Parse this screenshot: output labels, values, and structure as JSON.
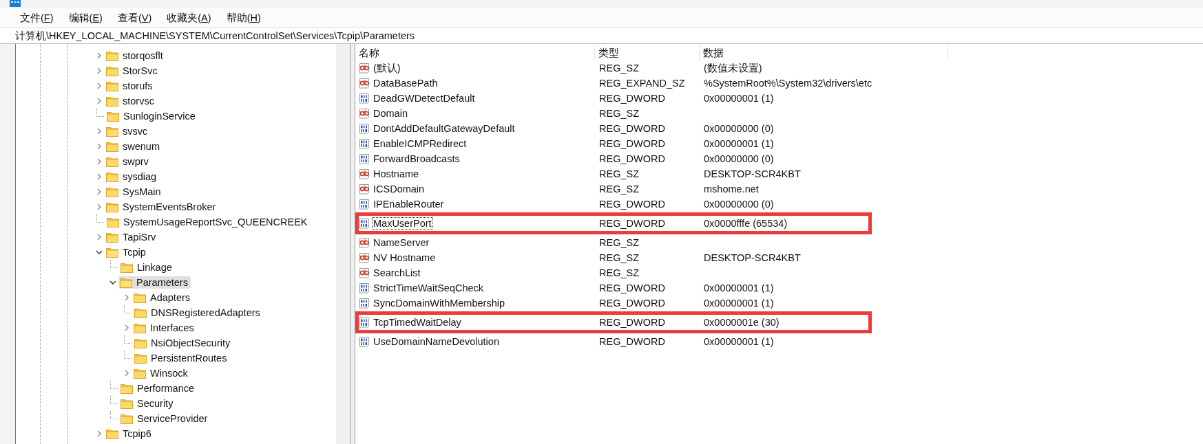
{
  "menu": [
    {
      "before": "文件(",
      "key": "F",
      "after": ")"
    },
    {
      "before": "编辑(",
      "key": "E",
      "after": ")"
    },
    {
      "before": "查看(",
      "key": "V",
      "after": ")"
    },
    {
      "before": "收藏夹(",
      "key": "A",
      "after": ")"
    },
    {
      "before": "帮助(",
      "key": "H",
      "after": ")"
    }
  ],
  "address": "计算机\\HKEY_LOCAL_MACHINE\\SYSTEM\\CurrentControlSet\\Services\\Tcpip\\Parameters",
  "tree": [
    {
      "label": "storqosflt",
      "expandable": true,
      "expanded": false,
      "selected": false
    },
    {
      "label": "StorSvc",
      "expandable": true,
      "expanded": false,
      "selected": false
    },
    {
      "label": "storufs",
      "expandable": true,
      "expanded": false,
      "selected": false
    },
    {
      "label": "storvsc",
      "expandable": true,
      "expanded": false,
      "selected": false
    },
    {
      "label": "SunloginService",
      "expandable": false,
      "selected": false
    },
    {
      "label": "svsvc",
      "expandable": true,
      "expanded": false,
      "selected": false
    },
    {
      "label": "swenum",
      "expandable": true,
      "expanded": false,
      "selected": false
    },
    {
      "label": "swprv",
      "expandable": true,
      "expanded": false,
      "selected": false
    },
    {
      "label": "sysdiag",
      "expandable": true,
      "expanded": false,
      "selected": false
    },
    {
      "label": "SysMain",
      "expandable": true,
      "expanded": false,
      "selected": false
    },
    {
      "label": "SystemEventsBroker",
      "expandable": true,
      "expanded": false,
      "selected": false
    },
    {
      "label": "SystemUsageReportSvc_QUEENCREEK",
      "expandable": false,
      "selected": false
    },
    {
      "label": "TapiSrv",
      "expandable": true,
      "expanded": false,
      "selected": false
    },
    {
      "label": "Tcpip",
      "expandable": true,
      "expanded": true,
      "selected": false,
      "children": [
        {
          "label": "Linkage",
          "expandable": false,
          "selected": false
        },
        {
          "label": "Parameters",
          "expandable": true,
          "expanded": true,
          "selected": true,
          "children": [
            {
              "label": "Adapters",
              "expandable": true,
              "expanded": false,
              "selected": false
            },
            {
              "label": "DNSRegisteredAdapters",
              "expandable": false,
              "selected": false
            },
            {
              "label": "Interfaces",
              "expandable": true,
              "expanded": false,
              "selected": false
            },
            {
              "label": "NsiObjectSecurity",
              "expandable": false,
              "selected": false
            },
            {
              "label": "PersistentRoutes",
              "expandable": false,
              "selected": false
            },
            {
              "label": "Winsock",
              "expandable": true,
              "expanded": false,
              "selected": false
            }
          ]
        },
        {
          "label": "Performance",
          "expandable": false,
          "selected": false
        },
        {
          "label": "Security",
          "expandable": false,
          "selected": false
        },
        {
          "label": "ServiceProvider",
          "expandable": false,
          "selected": false
        }
      ]
    },
    {
      "label": "Tcpip6",
      "expandable": true,
      "expanded": false,
      "selected": false
    }
  ],
  "columns": [
    "名称",
    "类型",
    "数据"
  ],
  "values": [
    {
      "kind": "string",
      "name": "(默认)",
      "type": "REG_SZ",
      "data": "(数值未设置)",
      "focused": false,
      "highlighted": false
    },
    {
      "kind": "string",
      "name": "DataBasePath",
      "type": "REG_EXPAND_SZ",
      "data": "%SystemRoot%\\System32\\drivers\\etc",
      "focused": false,
      "highlighted": false
    },
    {
      "kind": "dword",
      "name": "DeadGWDetectDefault",
      "type": "REG_DWORD",
      "data": "0x00000001 (1)",
      "focused": false,
      "highlighted": false
    },
    {
      "kind": "string",
      "name": "Domain",
      "type": "REG_SZ",
      "focused": false,
      "highlighted": false
    },
    {
      "kind": "dword",
      "name": "DontAddDefaultGatewayDefault",
      "type": "REG_DWORD",
      "data": "0x00000000 (0)",
      "focused": false,
      "highlighted": false
    },
    {
      "kind": "dword",
      "name": "EnableICMPRedirect",
      "type": "REG_DWORD",
      "data": "0x00000001 (1)",
      "focused": false,
      "highlighted": false
    },
    {
      "kind": "dword",
      "name": "ForwardBroadcasts",
      "type": "REG_DWORD",
      "data": "0x00000000 (0)",
      "focused": false,
      "highlighted": false
    },
    {
      "kind": "string",
      "name": "Hostname",
      "type": "REG_SZ",
      "data": "DESKTOP-SCR4KBT",
      "focused": false,
      "highlighted": false
    },
    {
      "kind": "string",
      "name": "ICSDomain",
      "type": "REG_SZ",
      "data": "mshome.net",
      "focused": false,
      "highlighted": false
    },
    {
      "kind": "dword",
      "name": "IPEnableRouter",
      "type": "REG_DWORD",
      "data": "0x00000000 (0)",
      "focused": false,
      "highlighted": false
    },
    {
      "kind": "dword",
      "name": "MaxUserPort",
      "type": "REG_DWORD",
      "data": "0x0000fffe (65534)",
      "focused": true,
      "highlighted": true
    },
    {
      "kind": "string",
      "name": "NameServer",
      "type": "REG_SZ",
      "focused": false,
      "highlighted": false
    },
    {
      "kind": "string",
      "name": "NV Hostname",
      "type": "REG_SZ",
      "data": "DESKTOP-SCR4KBT",
      "focused": false,
      "highlighted": false
    },
    {
      "kind": "string",
      "name": "SearchList",
      "type": "REG_SZ",
      "focused": false,
      "highlighted": false
    },
    {
      "kind": "dword",
      "name": "StrictTimeWaitSeqCheck",
      "type": "REG_DWORD",
      "data": "0x00000001 (1)",
      "focused": false,
      "highlighted": false
    },
    {
      "kind": "dword",
      "name": "SyncDomainWithMembership",
      "type": "REG_DWORD",
      "data": "0x00000001 (1)",
      "focused": false,
      "highlighted": false
    },
    {
      "kind": "dword",
      "name": "TcpTimedWaitDelay",
      "type": "REG_DWORD",
      "data": "0x0000001e (30)",
      "focused": false,
      "highlighted": true
    },
    {
      "kind": "dword",
      "name": "UseDomainNameDevolution",
      "type": "REG_DWORD",
      "data": "0x00000001 (1)",
      "focused": false,
      "highlighted": false
    }
  ]
}
